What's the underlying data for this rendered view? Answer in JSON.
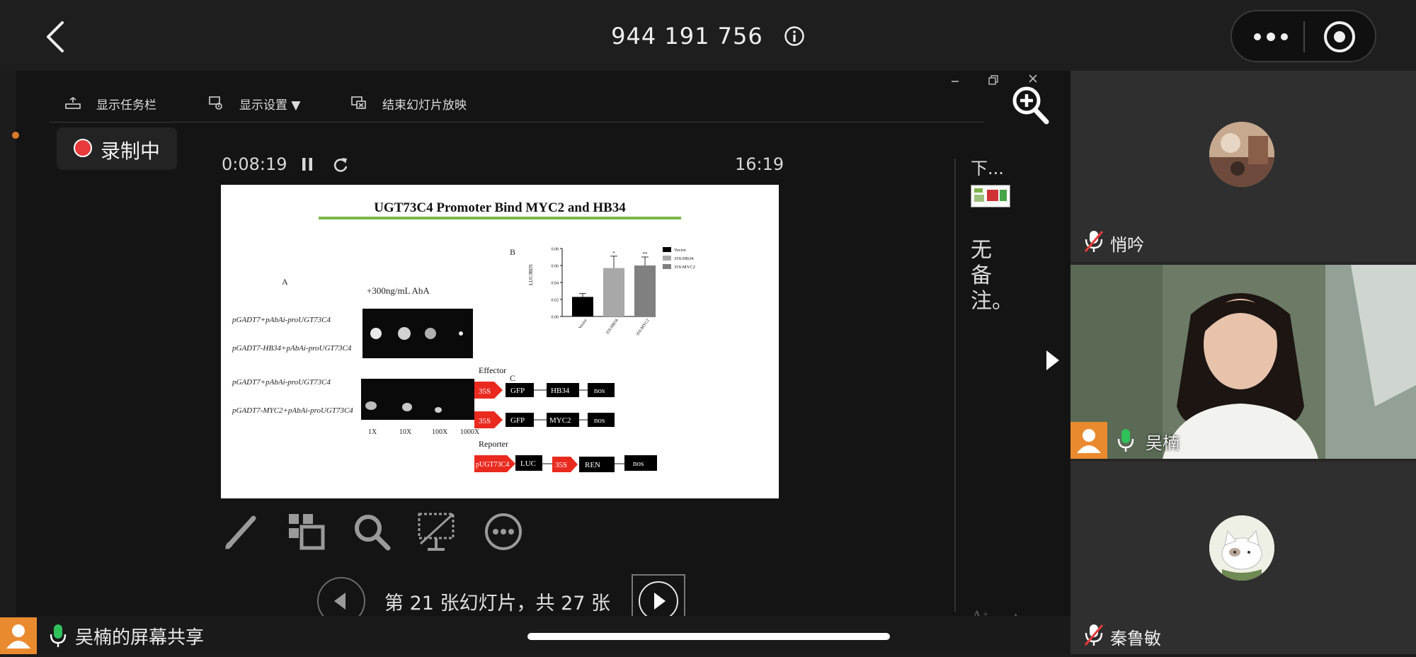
{
  "header": {
    "meeting_id": "944 191 756"
  },
  "toolbar": {
    "show_taskbar": "显示任务栏",
    "display_settings": "显示设置 ▼",
    "end_slideshow": "结束幻灯片放映"
  },
  "recording": {
    "label": "录制中"
  },
  "presenter": {
    "elapsed": "0:08:19",
    "clock": "16:19",
    "next_label": "下...",
    "notes": "无备注。",
    "slide_counter": "第 21 张幻灯片，共 27 张",
    "progress": 0.778
  },
  "slide": {
    "title": "UGT73C4 Promoter Bind  MYC2 and  HB34",
    "panel_a": "A",
    "panel_b": "B",
    "panel_c": "C",
    "aba": "+300ng/mL AbA",
    "row1": "pGADT7+pAbAi-proUGT73C4",
    "row2": "pGADT7-HB34+pAbAi-proUGT73C4",
    "row3": "pGADT7+pAbAi-proUGT73C4",
    "row4": "pGADT7-MYC2+pAbAi-proUGT73C4",
    "dil": [
      "1X",
      "10X",
      "100X",
      "1000X"
    ],
    "effector": "Effector",
    "reporter": "Reporter",
    "p35s": "35S",
    "gfp": "GFP",
    "hb34": "HB34",
    "myc2": "MYC2",
    "nos": "nos",
    "pugt": "pUGT73C4",
    "luc": "LUC",
    "ren": "REN"
  },
  "chart_data": {
    "type": "bar",
    "categories": [
      "Vector",
      "35S:HB34",
      "35S:MYC2"
    ],
    "values": [
      0.023,
      0.057,
      0.06
    ],
    "errors": [
      0.004,
      0.014,
      0.01
    ],
    "significance": [
      "",
      "*",
      "**"
    ],
    "ylabel": "LUC/REN",
    "ylim": [
      0,
      0.08
    ],
    "yticks": [
      "0.00",
      "0.02",
      "0.04",
      "0.06",
      "0.08"
    ],
    "legend": [
      "Vector",
      "35S:HB34",
      "35S:MYC2"
    ],
    "colors": [
      "#000000",
      "#a8a8a8",
      "#808080"
    ]
  },
  "participants": [
    {
      "name": "悄吟"
    },
    {
      "name": "吴楠"
    },
    {
      "name": "秦鲁敏"
    }
  ],
  "share": {
    "label": "吴楠的屏幕共享"
  }
}
